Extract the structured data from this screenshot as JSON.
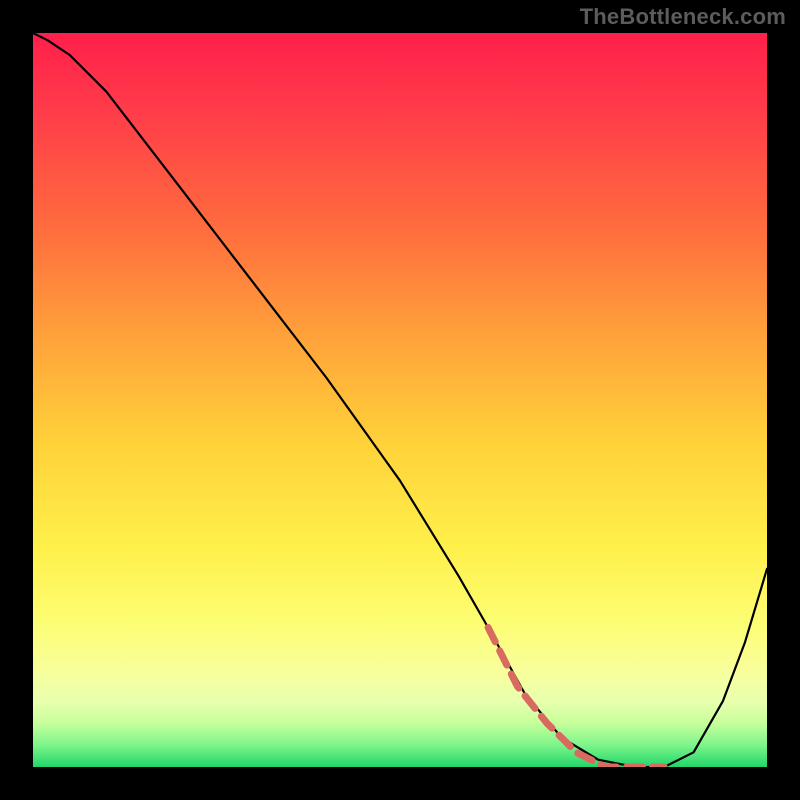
{
  "watermark": "TheBottleneck.com",
  "chart_data": {
    "type": "line",
    "title": "",
    "xlabel": "",
    "ylabel": "",
    "xlim": [
      0,
      100
    ],
    "ylim": [
      0,
      100
    ],
    "grid": false,
    "legend": false,
    "series": [
      {
        "name": "curve",
        "color": "#000000",
        "x": [
          0,
          2,
          5,
          10,
          20,
          30,
          40,
          50,
          58,
          62,
          67,
          72,
          77,
          82,
          86,
          90,
          94,
          97,
          100
        ],
        "y": [
          100,
          99,
          97,
          92,
          79,
          66,
          53,
          39,
          26,
          19,
          10,
          4,
          1,
          0,
          0,
          2,
          9,
          17,
          27
        ]
      },
      {
        "name": "highlight",
        "color": "#d86a60",
        "x": [
          62,
          66,
          70,
          74,
          78,
          82,
          86
        ],
        "y": [
          19,
          11,
          6,
          2,
          0,
          0,
          0
        ]
      }
    ],
    "gradient_stops": [
      {
        "pos": 0.0,
        "color": "#ff1f4b"
      },
      {
        "pos": 0.26,
        "color": "#ff6a3e"
      },
      {
        "pos": 0.56,
        "color": "#ffd23a"
      },
      {
        "pos": 0.8,
        "color": "#fdfd72"
      },
      {
        "pos": 0.94,
        "color": "#c7ff9c"
      },
      {
        "pos": 1.0,
        "color": "#22d66a"
      }
    ]
  }
}
